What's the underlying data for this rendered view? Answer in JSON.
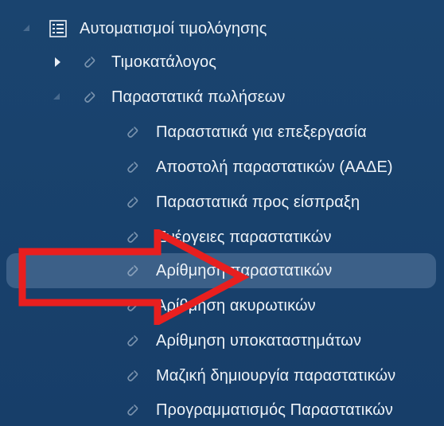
{
  "colors": {
    "background": "#173f6b",
    "text": "#eef3f8",
    "selected_row": "#5a7a9e",
    "arrow": "#e81f1f"
  },
  "tree": {
    "root": {
      "label": "Αυτοματισμοί τιμολόγησης",
      "icon": "list-icon",
      "expanded": true
    },
    "children": [
      {
        "label": "Τιμοκατάλογος",
        "icon": "link-icon",
        "expanded": false
      },
      {
        "label": "Παραστατικά πωλήσεων",
        "icon": "link-icon",
        "expanded": true
      }
    ],
    "sales_items": [
      {
        "label": "Παραστατικά για επεξεργασία",
        "icon": "link-icon"
      },
      {
        "label": "Αποστολή παραστατικών (ΑΑΔΕ)",
        "icon": "link-icon"
      },
      {
        "label": "Παραστατικά προς είσπραξη",
        "icon": "link-icon"
      },
      {
        "label": "Ενέργειες παραστατικών",
        "icon": "link-icon"
      },
      {
        "label": "Αρίθμηση παραστατικών",
        "icon": "link-icon",
        "selected": true
      },
      {
        "label": "Αρίθμηση ακυρωτικών",
        "icon": "link-icon"
      },
      {
        "label": "Αρίθμηση υποκαταστημάτων",
        "icon": "link-icon"
      },
      {
        "label": "Μαζική δημιουργία παραστατικών",
        "icon": "link-icon"
      },
      {
        "label": "Προγραμματισμός Παραστατικών",
        "icon": "link-icon"
      }
    ]
  },
  "annotation": {
    "icon": "red-arrow-icon"
  }
}
